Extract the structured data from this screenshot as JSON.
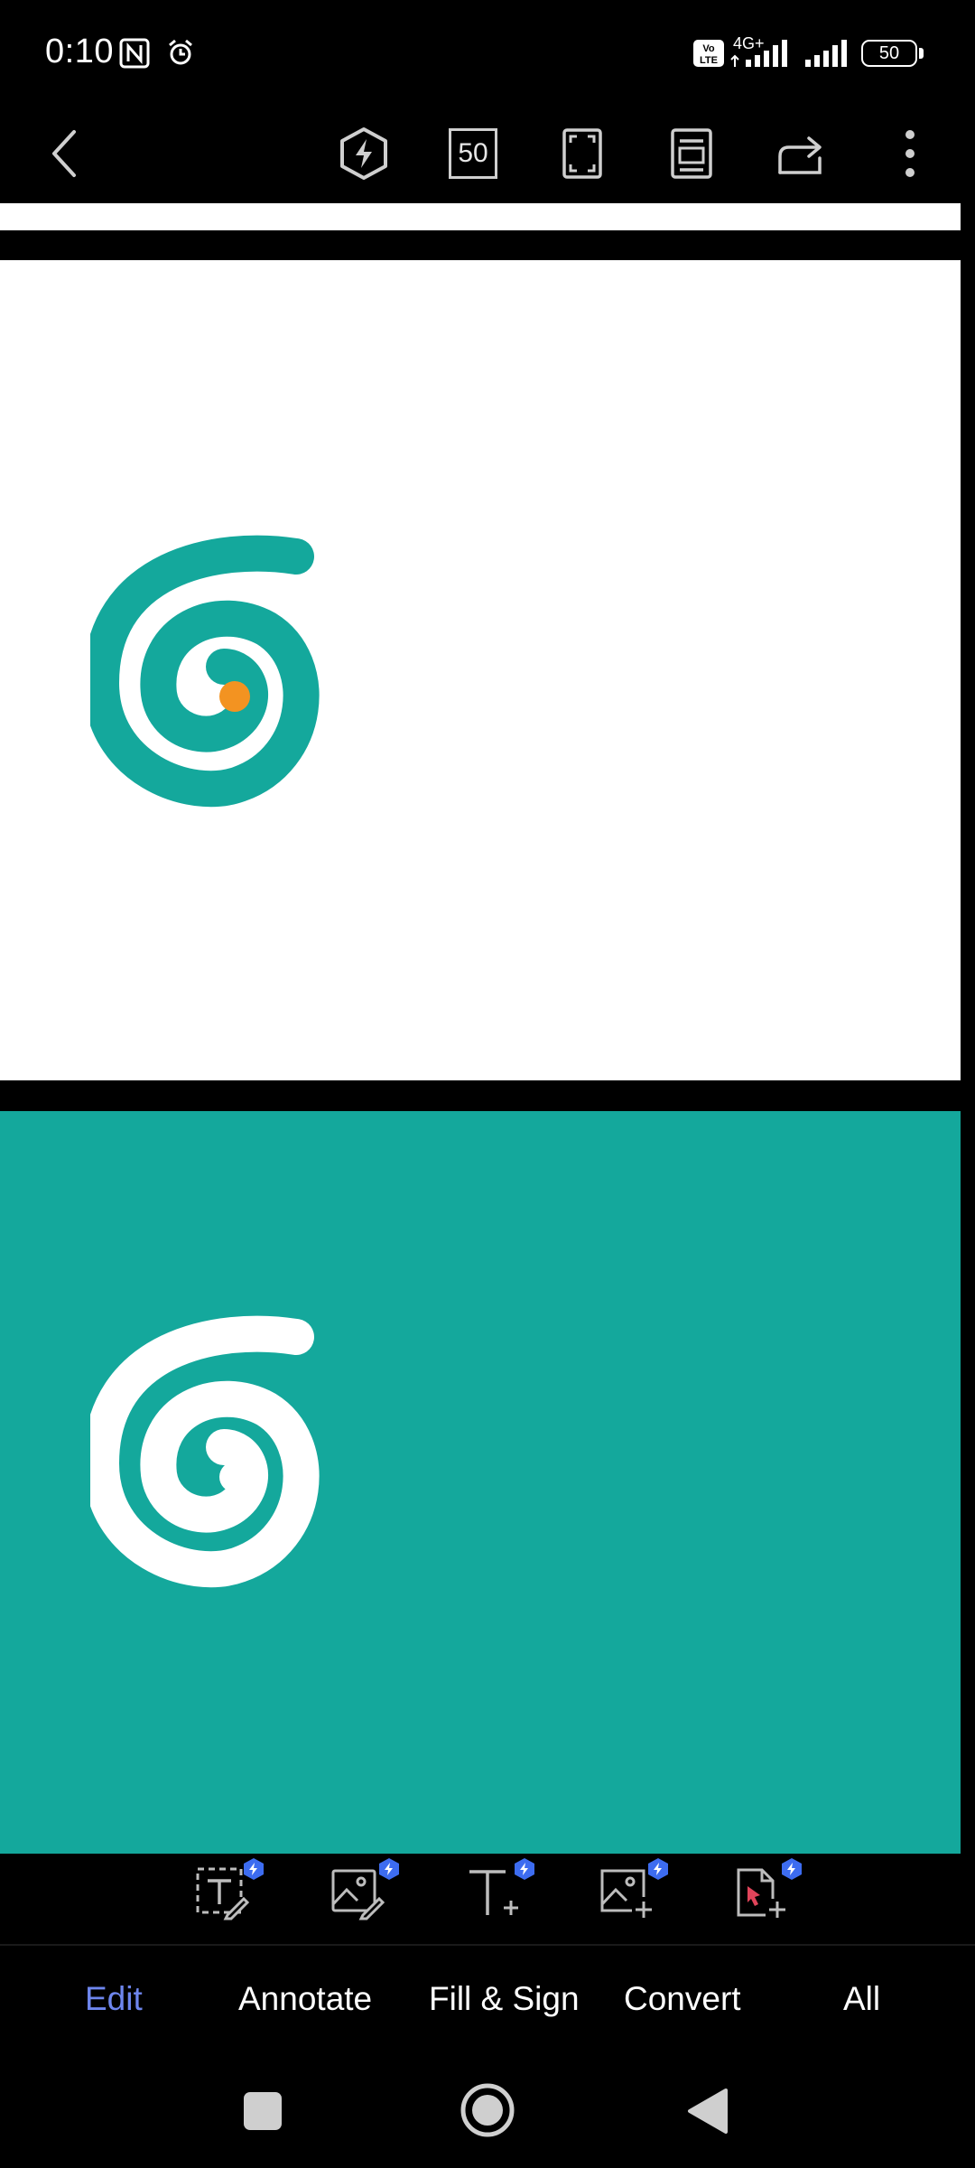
{
  "status_bar": {
    "time": "0:10",
    "network_label": "4G+",
    "volte_label": "Vo LTE",
    "battery_level": "50",
    "icons": [
      "nfc-icon",
      "alarm-icon",
      "volte-icon",
      "signal-icon",
      "signal-icon",
      "battery-icon"
    ]
  },
  "toolbar": {
    "zoom_label": "50",
    "icons": [
      "back-icon",
      "premium-bolt-icon",
      "zoom-level",
      "fullscreen-icon",
      "page-view-icon",
      "share-icon",
      "more-icon"
    ]
  },
  "document": {
    "pages": [
      {
        "background": "#ffffff",
        "logo": "spiral-logo",
        "logo_color": "#14a89c",
        "dot_color": "#f39321"
      },
      {
        "background": "#14a89c",
        "logo": "spiral-logo",
        "logo_color": "#ffffff"
      }
    ]
  },
  "edit_tools": {
    "items": [
      {
        "icon": "edit-text-icon"
      },
      {
        "icon": "edit-image-icon"
      },
      {
        "icon": "add-text-icon"
      },
      {
        "icon": "add-image-icon"
      },
      {
        "icon": "add-page-icon"
      }
    ],
    "badge_icon": "bolt-badge-icon"
  },
  "tabs": [
    {
      "label": "Edit",
      "active": true
    },
    {
      "label": "Annotate",
      "active": false
    },
    {
      "label": "Fill & Sign",
      "active": false
    },
    {
      "label": "Convert",
      "active": false
    },
    {
      "label": "All",
      "active": false
    }
  ],
  "nav_bar": {
    "icons": [
      "recents-icon",
      "home-icon",
      "back-nav-icon"
    ]
  },
  "colors": {
    "accent": "#6e86ee",
    "teal": "#14a89c",
    "orange": "#f39321",
    "badge": "#3d6cf0"
  }
}
